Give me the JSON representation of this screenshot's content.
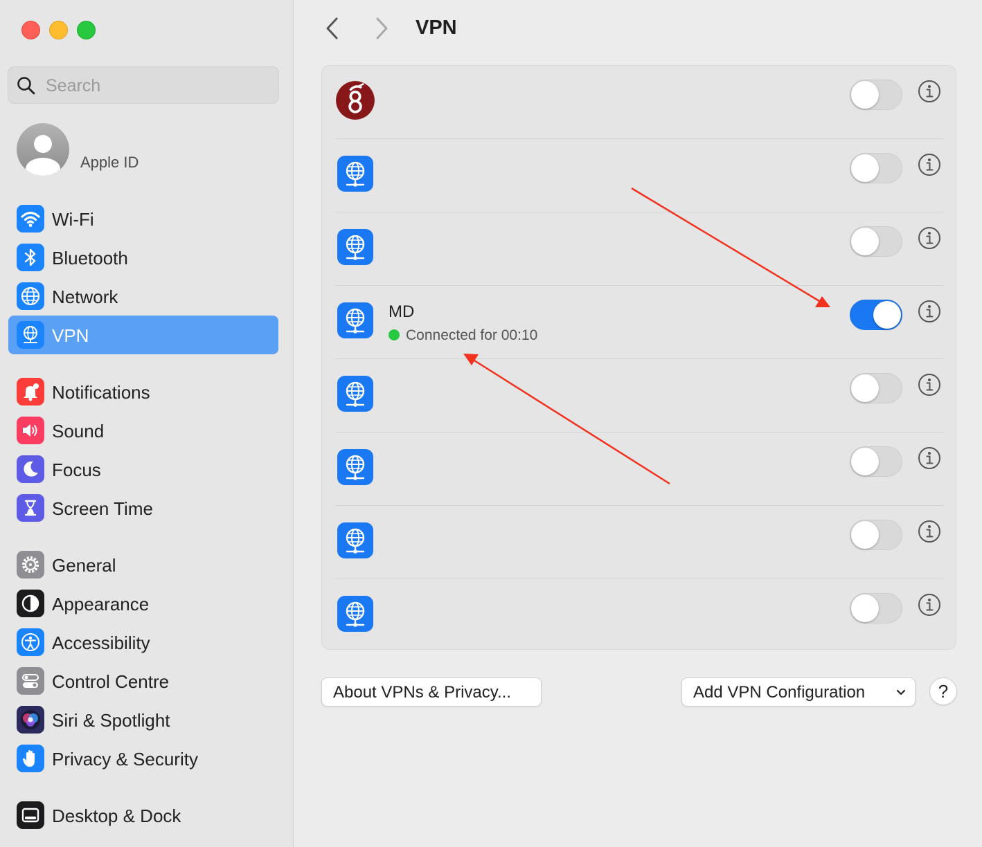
{
  "window": {
    "title": "VPN"
  },
  "search": {
    "placeholder": "Search",
    "value": ""
  },
  "apple_id": {
    "label": "Apple ID"
  },
  "sidebar": {
    "items": [
      {
        "label": "Wi-Fi",
        "icon": "wifi-icon",
        "color": "#1a84ff"
      },
      {
        "label": "Bluetooth",
        "icon": "bluetooth-icon",
        "color": "#1a84ff"
      },
      {
        "label": "Network",
        "icon": "globe-icon",
        "color": "#1a84ff"
      },
      {
        "label": "VPN",
        "icon": "vpn-globe-icon",
        "color": "#1a84ff",
        "selected": true
      },
      {
        "label": "Notifications",
        "icon": "bell-icon",
        "color": "#fc3d39"
      },
      {
        "label": "Sound",
        "icon": "speaker-icon",
        "color": "#fc3d62"
      },
      {
        "label": "Focus",
        "icon": "moon-icon",
        "color": "#5e5ce6"
      },
      {
        "label": "Screen Time",
        "icon": "hourglass-icon",
        "color": "#5e5ce6"
      },
      {
        "label": "General",
        "icon": "gear-icon",
        "color": "#8e8e93"
      },
      {
        "label": "Appearance",
        "icon": "appearance-icon",
        "color": "#1c1c1e"
      },
      {
        "label": "Accessibility",
        "icon": "accessibility-icon",
        "color": "#1a84ff"
      },
      {
        "label": "Control Centre",
        "icon": "control-centre-icon",
        "color": "#8e8e93"
      },
      {
        "label": "Siri & Spotlight",
        "icon": "siri-icon",
        "color": "#2b2b5e"
      },
      {
        "label": "Privacy & Security",
        "icon": "hand-icon",
        "color": "#1a84ff"
      },
      {
        "label": "Desktop & Dock",
        "icon": "dock-icon",
        "color": "#1c1c1e"
      }
    ]
  },
  "vpn_list": [
    {
      "name": "",
      "status": "",
      "icon": "wireguard-icon",
      "on": false
    },
    {
      "name": "",
      "status": "",
      "icon": "vpn-globe-icon",
      "on": false
    },
    {
      "name": "",
      "status": "",
      "icon": "vpn-globe-icon",
      "on": false
    },
    {
      "name": "MD",
      "status": "Connected for 00:10",
      "icon": "vpn-globe-icon",
      "on": true
    },
    {
      "name": "",
      "status": "",
      "icon": "vpn-globe-icon",
      "on": false
    },
    {
      "name": "",
      "status": "",
      "icon": "vpn-globe-icon",
      "on": false
    },
    {
      "name": "",
      "status": "",
      "icon": "vpn-globe-icon",
      "on": false
    },
    {
      "name": "",
      "status": "",
      "icon": "vpn-globe-icon",
      "on": false
    }
  ],
  "buttons": {
    "about": "About VPNs & Privacy...",
    "add": "Add VPN Configuration",
    "help": "?"
  },
  "colors": {
    "accent": "#1a78f2",
    "selection": "#5aa1f6",
    "annotation": "#f0321e",
    "connected": "#28c840"
  }
}
